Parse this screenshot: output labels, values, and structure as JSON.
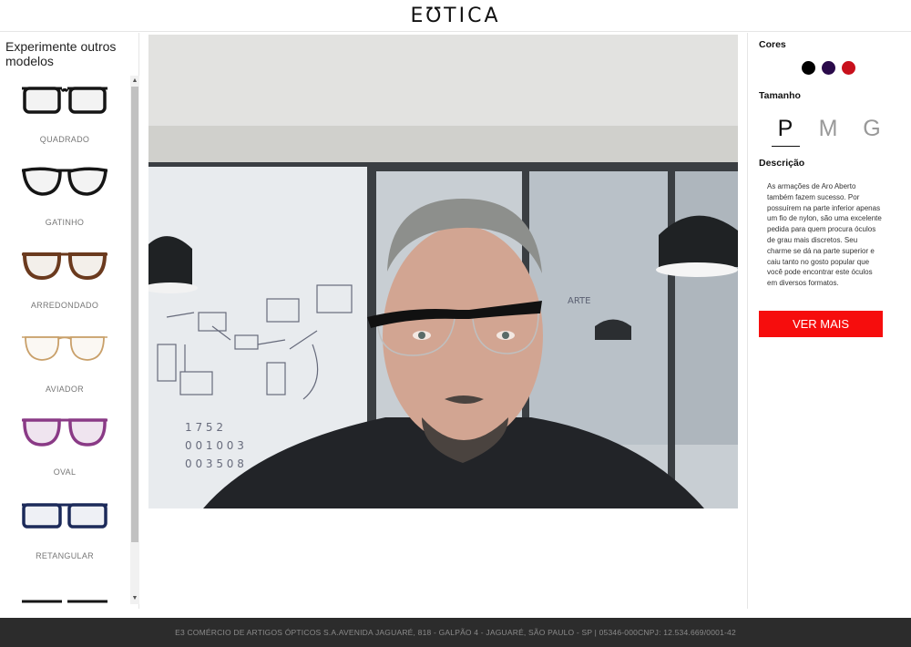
{
  "header": {
    "logo": "EƱTICA"
  },
  "sidebar": {
    "title": "Experimente outros modelos",
    "models": [
      {
        "label": "QUADRADO",
        "frame_color": "#151515",
        "shape": "square"
      },
      {
        "label": "GATINHO",
        "frame_color": "#151515",
        "shape": "cat-eye"
      },
      {
        "label": "ARREDONDADO",
        "frame_color": "#6b3a1e",
        "shape": "round"
      },
      {
        "label": "AVIADOR",
        "frame_color": "#c9a06a",
        "shape": "aviator"
      },
      {
        "label": "OVAL",
        "frame_color": "#8a3a86",
        "shape": "oval"
      },
      {
        "label": "RETANGULAR",
        "frame_color": "#1c2a5a",
        "shape": "rectangular"
      }
    ],
    "scroll_up_icon": "chevron-up-icon",
    "scroll_down_icon": "chevron-down-icon"
  },
  "camera": {
    "content": "webcam-try-on-feed",
    "overlay_frame_color": "#111111"
  },
  "right": {
    "colors_title": "Cores",
    "colors": [
      "#000000",
      "#2a0a4a",
      "#c8101c"
    ],
    "size_title": "Tamanho",
    "sizes": [
      "P",
      "M",
      "G"
    ],
    "selected_size": "P",
    "desc_title": "Descrição",
    "description": "As armações de Aro Aberto também fazem sucesso. Por possuírem na parte inferior apenas um fio de nylon, são uma excelente pedida para quem procura óculos de grau mais discretos. Seu charme se dá na parte superior e caiu tanto no gosto popular que você pode encontrar este óculos em diversos formatos.",
    "button": "VER MAIS"
  },
  "footer": {
    "text": "E3 COMÉRCIO DE ARTIGOS ÓPTICOS S.A.AVENIDA JAGUARÉ, 818 - GALPÃO 4 - JAGUARÉ, SÃO PAULO - SP | 05346-000CNPJ: 12.534.669/0001-42"
  },
  "colors": {
    "accent": "#f60d0d",
    "footer_bg": "#2c2c2c"
  }
}
